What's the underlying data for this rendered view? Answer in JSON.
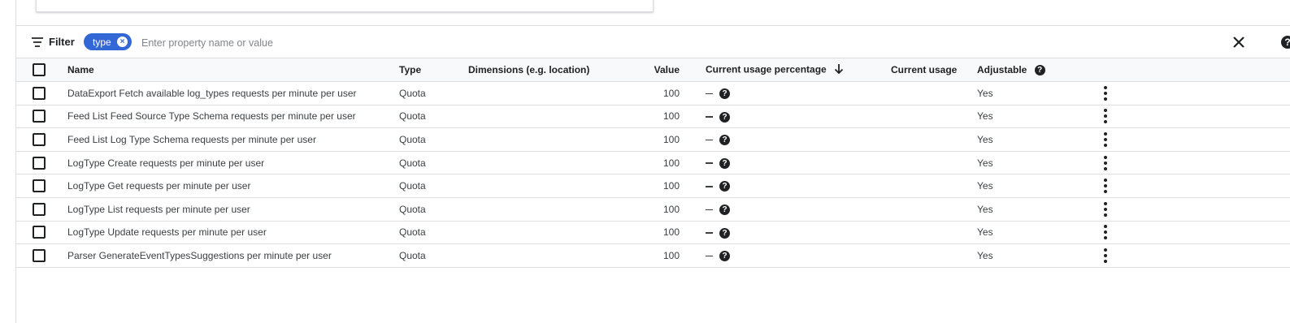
{
  "filter": {
    "label": "Filter",
    "chip_label": "type",
    "placeholder": "Enter property name or value"
  },
  "columns": {
    "name": "Name",
    "type": "Type",
    "dimensions": "Dimensions (e.g. location)",
    "value": "Value",
    "current_usage_percentage": "Current usage percentage",
    "current_usage": "Current usage",
    "adjustable": "Adjustable"
  },
  "rows": [
    {
      "name": "DataExport Fetch available log_types requests per minute per user",
      "type": "Quota",
      "value": "100",
      "adjustable": "Yes"
    },
    {
      "name": "Feed List Feed Source Type Schema requests per minute per user",
      "type": "Quota",
      "value": "100",
      "adjustable": "Yes"
    },
    {
      "name": "Feed List Log Type Schema requests per minute per user",
      "type": "Quota",
      "value": "100",
      "adjustable": "Yes"
    },
    {
      "name": "LogType Create requests per minute per user",
      "type": "Quota",
      "value": "100",
      "adjustable": "Yes"
    },
    {
      "name": "LogType Get requests per minute per user",
      "type": "Quota",
      "value": "100",
      "adjustable": "Yes"
    },
    {
      "name": "LogType List requests per minute per user",
      "type": "Quota",
      "value": "100",
      "adjustable": "Yes"
    },
    {
      "name": "LogType Update requests per minute per user",
      "type": "Quota",
      "value": "100",
      "adjustable": "Yes"
    },
    {
      "name": "Parser GenerateEventTypesSuggestions per minute per user",
      "type": "Quota",
      "value": "100",
      "adjustable": "Yes"
    }
  ],
  "icons": {
    "filter": "filter-list-icon",
    "chip_remove": "cancel-icon",
    "close": "close-icon",
    "help": "help-icon",
    "sort": "arrow-downward-icon",
    "row_menu": "more-vert-icon"
  },
  "colors": {
    "chip": "#3367d6",
    "header_bg": "#f8f9fa",
    "border": "#dadce0"
  }
}
